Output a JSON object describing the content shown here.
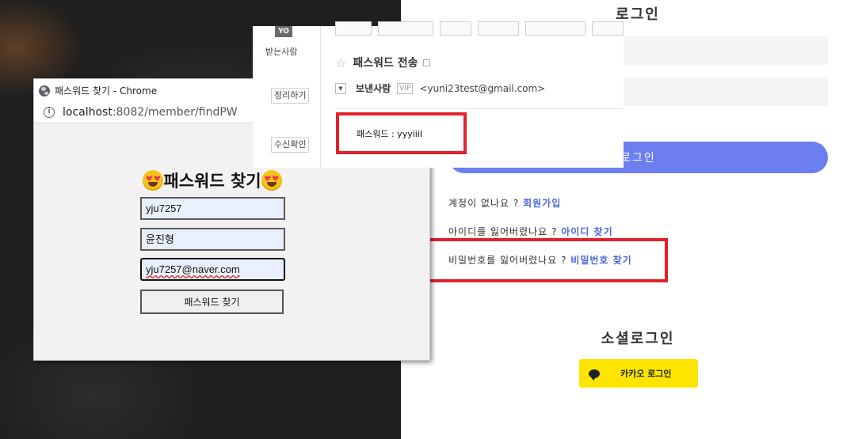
{
  "popup": {
    "window_title": "패스워드 찾기 - Chrome",
    "url_host": "localhost",
    "url_path": ":8082/member/findPW",
    "heading": "패스워드 찾기",
    "fields": {
      "userid": "yju7257",
      "name": "윤진형",
      "email": "yju7257@naver.com"
    },
    "submit_label": "패스워드 찾기"
  },
  "mail": {
    "to_badge": "YO",
    "recipient_label": "받는사람",
    "tidy_label": "정리하기",
    "receipt_label": "수신확인",
    "subject": "패스워드 전송",
    "sender_label": "보낸사람",
    "vip_label": "VIP",
    "sender_email": "<yuni23test@gmail.com>",
    "body_text": "패스워드 : yyyiiiI"
  },
  "login": {
    "title": "로그인",
    "button_label": "로그인",
    "signup_prompt": "계정이 없나요 ?",
    "signup_link": "회원가입",
    "find_id_prompt": "아이디를 잃어버렸나요 ?",
    "find_id_link": "아이디 찾기",
    "find_pw_prompt": "비밀번호를 잃어버렸나요 ?",
    "find_pw_link": "비밀번호 찾기",
    "social_title": "소셜로그인",
    "kakao_label": "카카오 로그인"
  },
  "colors": {
    "highlight": "#e3212b",
    "login_button": "#6b7ff0",
    "kakao": "#fee500",
    "link": "#4a66d8"
  }
}
